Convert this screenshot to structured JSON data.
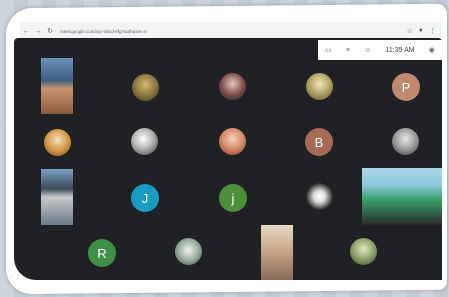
{
  "browser": {
    "url": "meet.google.com/xyz-abcd-efg?authuser=0"
  },
  "meeting": {
    "time": "11:35 AM"
  },
  "participants": [
    {
      "letter": "P",
      "color": "#c08a70"
    },
    {
      "letter": "B",
      "color": "#a66a57"
    },
    {
      "letter": "J",
      "color": "#1a9bc1"
    },
    {
      "letter": "j",
      "color": "#4e8f3c"
    },
    {
      "letter": "R",
      "color": "#3f8f47"
    }
  ]
}
